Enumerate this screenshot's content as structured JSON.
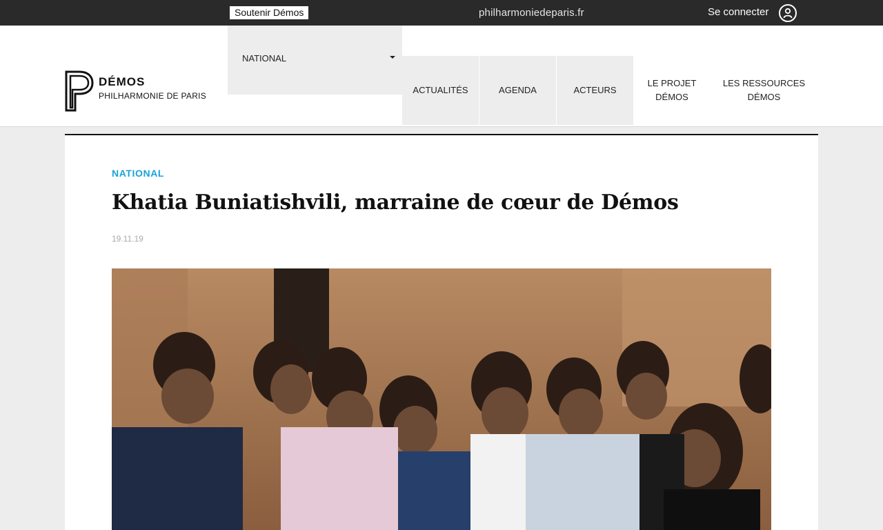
{
  "topbar": {
    "support_label": "Soutenir Démos",
    "site_link": "philharmoniedeparis.fr",
    "login_label": "Se connecter",
    "user_icon": "user-icon"
  },
  "logo": {
    "title": "DÉMOS",
    "subtitle": "PHILHARMONIE DE PARIS"
  },
  "nav": {
    "dropdown_label": "NATIONAL",
    "items": [
      {
        "label": "ACTUALITÉS"
      },
      {
        "label": "AGENDA"
      },
      {
        "label": "ACTEURS"
      },
      {
        "label": "LE PROJET DÉMOS"
      },
      {
        "label": "LES RESSOURCES DÉMOS"
      }
    ]
  },
  "article": {
    "category": "NATIONAL",
    "title": "Khatia Buniatishvili, marraine de cœur de Démos",
    "date": "19.11.19"
  },
  "colors": {
    "topbar_bg": "#2a2a2a",
    "accent": "#1aa3d8",
    "nav_bg": "#ededed"
  }
}
